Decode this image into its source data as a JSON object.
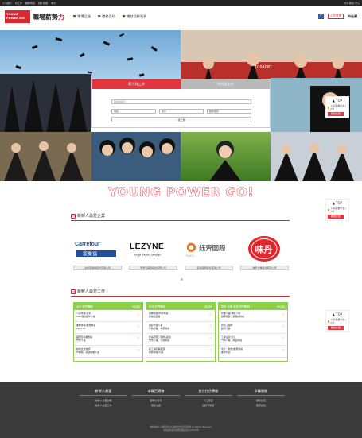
{
  "topbar": {
    "left_links": [
      "人力銀行",
      "好工作",
      "職務專區",
      "徵人啟事",
      "求才"
    ],
    "right_text": "分享  歡迎  登入"
  },
  "header": {
    "logo_line1": "YOUNG",
    "logo_line2": "POWER GO!",
    "title_main": "職場薪勢",
    "title_accent": "力",
    "nav": [
      {
        "icon": "graduation-cap-icon",
        "label": "職場之鑰"
      },
      {
        "icon": "graduation-cap-icon",
        "label": "職務百科"
      },
      {
        "icon": "graduation-cap-icon",
        "label": "職缺比較列表"
      }
    ],
    "tv_badge": "公共電視",
    "tv_label": "中台灣"
  },
  "collage_texts": {
    "gown_tag": "1004081"
  },
  "search": {
    "tab_active": "薪力找工作",
    "tab_inactive": "特別找工作",
    "placeholder": "職缺關鍵字",
    "selects": [
      "地區",
      "薪水",
      "職務類別"
    ],
    "button": "找工作"
  },
  "side_widget_1": {
    "top_label": "TOP",
    "row_label": "人氣職業列表 | 0筆",
    "red_button": "職缺比較"
  },
  "side_widget_2": {
    "top_label": "TOP",
    "row_label": "人氣職業列表 | 0筆",
    "red_button": "職缺比較"
  },
  "side_widget_3": {
    "top_label": "TOP",
    "row_label": "人氣職業列表 | 0筆",
    "red_button": "職缺比較"
  },
  "banner_text": "YOUNG POWER GO!",
  "companies_section": {
    "title": "新鮮人最愛企業",
    "title_badge": "HI",
    "companies": [
      {
        "name_line1": "Carrefour",
        "name_line2": "家樂福",
        "button": "法商家樂福股份有限公司"
      },
      {
        "name_line1": "LEZYNE",
        "name_line2": "Engineered Design",
        "button": "里奧德國際股份有限公司"
      },
      {
        "name_line1": "鈺齊國際",
        "name_line2": "Tophill Co.",
        "button": "鈺齊國際股份有限公司"
      },
      {
        "name_line1": "味丹",
        "name_line2": "",
        "button": "味丹企業股份有限公司"
      }
    ]
  },
  "jobs_section": {
    "title": "新鮮人最愛工作",
    "title_badge": "HI",
    "columns": [
      {
        "head": "台中·熱門職缺",
        "more": "MORE",
        "rows": [
          [
            "人資專員/主管",
            "CNC機台操作人員"
          ],
          [
            "業務專員/業務專員",
            "Lead 02"
          ],
          [
            "國際貿易業務員",
            "門市人員"
          ],
          [
            "線材生產技師",
            "作業員、倉儲作業人員"
          ]
        ]
      },
      {
        "head": "彰化·熱門職缺",
        "more": "MORE",
        "rows": [
          [
            "儲備幹部/外勤專員",
            "倉儲出貨員"
          ],
          [
            "儲存管理人員",
            "行政助理、財務專員"
          ],
          [
            "產品研發工程師(品質)",
            "門市人員、行政專員"
          ],
          [
            "員工福利事業部",
            "業務助理/行銷"
          ]
        ]
      },
      {
        "head": "雲林·嘉義·南投·熱門職缺",
        "more": "MORE",
        "rows": [
          [
            "作業人員/技術人員",
            "儲備幹部、製程技術員"
          ],
          [
            "研發工程師",
            "品管人員"
          ],
          [
            "工廠主管/主任",
            "門市人員、產品專員"
          ],
          [
            "會計、財務/業務專員",
            "業務代表"
          ]
        ]
      }
    ]
  },
  "footer": {
    "columns": [
      {
        "head": "新鮮人最愛",
        "links": [
          "新鮮人最愛企業",
          "新鮮人最愛工作"
        ]
      },
      {
        "head": "求職百寶箱",
        "links": [
          "職務大百科",
          "職場之鑰"
        ]
      },
      {
        "head": "其它特色專區",
        "links": [
          "打工專區",
          "國際博覽會"
        ]
      },
      {
        "head": "求職服務",
        "links": [
          "職缺比較",
          "履歷健檢"
        ]
      }
    ],
    "extra_links": [
      "",
      "",
      "中台灣",
      ""
    ],
    "copyright_1": "本網站由人力銀行與公共電視中台灣共同製作 All Rights Reserved.",
    "copyright_2": "本站建議使用瀏覽器解析度1024x768"
  },
  "colors": {
    "brand_red": "#d9282f",
    "job_green": "#8dd14b",
    "footer_bg": "#3a3a3a"
  }
}
